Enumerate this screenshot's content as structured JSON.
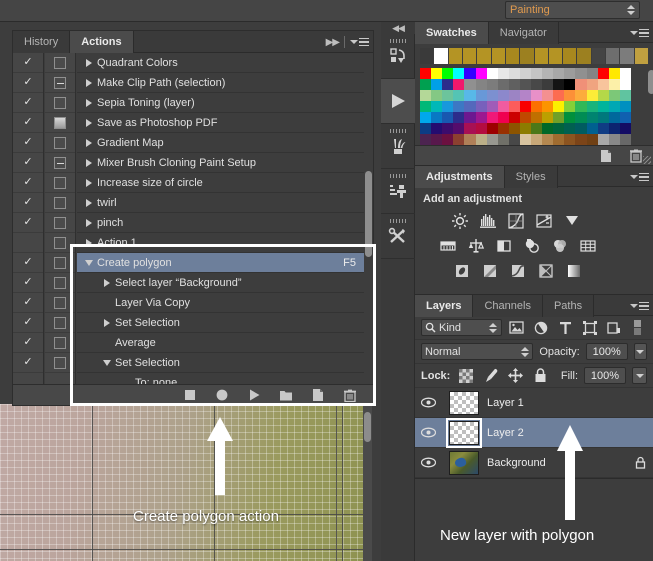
{
  "topbar": {
    "workspace": "Painting",
    "workspace_icon": "spinner-arrows-icon"
  },
  "actions_panel": {
    "tabs": [
      {
        "label": "History",
        "active": false
      },
      {
        "label": "Actions",
        "active": true
      }
    ],
    "header_icons": [
      "double-arrow-right-icon",
      "panel-menu-icon"
    ],
    "rows": [
      {
        "label": "Quadrant Colors",
        "indent": 0,
        "toggle": "right",
        "check": true,
        "dialog": "blank",
        "fkey": "",
        "selected": false
      },
      {
        "label": "Make Clip Path (selection)",
        "indent": 0,
        "toggle": "right",
        "check": true,
        "dialog": "dash",
        "fkey": "",
        "selected": false
      },
      {
        "label": "Sepia Toning (layer)",
        "indent": 0,
        "toggle": "right",
        "check": true,
        "dialog": "blank",
        "fkey": "",
        "selected": false
      },
      {
        "label": "Save as Photoshop PDF",
        "indent": 0,
        "toggle": "right",
        "check": true,
        "dialog": "filled",
        "fkey": "",
        "selected": false
      },
      {
        "label": "Gradient Map",
        "indent": 0,
        "toggle": "right",
        "check": true,
        "dialog": "blank",
        "fkey": "",
        "selected": false
      },
      {
        "label": "Mixer Brush Cloning Paint Setup",
        "indent": 0,
        "toggle": "right",
        "check": true,
        "dialog": "dash",
        "fkey": "",
        "selected": false
      },
      {
        "label": "Increase size of circle",
        "indent": 0,
        "toggle": "right",
        "check": true,
        "dialog": "blank",
        "fkey": "",
        "selected": false
      },
      {
        "label": "twirl",
        "indent": 0,
        "toggle": "right",
        "check": true,
        "dialog": "blank",
        "fkey": "",
        "selected": false
      },
      {
        "label": "pinch",
        "indent": 0,
        "toggle": "right",
        "check": true,
        "dialog": "blank",
        "fkey": "",
        "selected": false
      },
      {
        "label": "Action 1",
        "indent": 0,
        "toggle": "right",
        "check": false,
        "dialog": "blank",
        "fkey": "",
        "selected": false
      },
      {
        "label": "Create polygon",
        "indent": 0,
        "toggle": "down",
        "check": true,
        "dialog": "blank",
        "fkey": "F5",
        "selected": true
      },
      {
        "label": "Select layer “Background”",
        "indent": 1,
        "toggle": "right",
        "check": true,
        "dialog": "blank",
        "fkey": "",
        "selected": false
      },
      {
        "label": "Layer Via Copy",
        "indent": 1,
        "toggle": "none",
        "check": true,
        "dialog": "blank",
        "fkey": "",
        "selected": false
      },
      {
        "label": "Set Selection",
        "indent": 1,
        "toggle": "right",
        "check": true,
        "dialog": "blank",
        "fkey": "",
        "selected": false
      },
      {
        "label": "Average",
        "indent": 1,
        "toggle": "none",
        "check": true,
        "dialog": "blank",
        "fkey": "",
        "selected": false
      },
      {
        "label": "Set Selection",
        "indent": 1,
        "toggle": "down",
        "check": true,
        "dialog": "blank",
        "fkey": "",
        "selected": false
      },
      {
        "label": "To: none",
        "indent": 2,
        "toggle": "none",
        "check": false,
        "dialog": "none",
        "fkey": "",
        "selected": false
      }
    ],
    "footer_buttons": [
      {
        "name": "stop-recording-button",
        "icon": "square-icon"
      },
      {
        "name": "begin-recording-button",
        "icon": "circle-icon"
      },
      {
        "name": "play-selection-button",
        "icon": "play-triangle-icon"
      },
      {
        "name": "create-new-set-button",
        "icon": "folder-icon"
      },
      {
        "name": "create-new-action-button",
        "icon": "new-page-icon"
      },
      {
        "name": "delete-button",
        "icon": "trash-icon"
      }
    ]
  },
  "dock": {
    "items": [
      {
        "name": "mini-bridge-panel",
        "icon": "mini-bridge-icon",
        "active": false
      },
      {
        "name": "actions-play-panel",
        "icon": "play-triangle-icon",
        "active": true
      },
      {
        "name": "brush-presets-panel",
        "icon": "brushes-icon",
        "active": false
      },
      {
        "name": "clone-source-panel",
        "icon": "clone-stamp-icon",
        "active": false
      },
      {
        "name": "tool-presets-panel",
        "icon": "tools-cross-icon",
        "active": false
      }
    ]
  },
  "swatches_panel": {
    "tabs": [
      {
        "label": "Swatches",
        "active": true
      },
      {
        "label": "Navigator",
        "active": false
      }
    ],
    "recent": [
      "#3a3a3a",
      "#ffffff",
      "#b49424",
      "#b49424",
      "#b49424",
      "#b49424",
      "#a8881e",
      "#9c8020",
      "#b49424",
      "#b49424",
      "#a8881e",
      "#9c8020",
      "#444444",
      "#6e6e6e",
      "#7c7c7c",
      "#c0a040"
    ],
    "grid": [
      [
        "#ff0000",
        "#ffff00",
        "#00ff00",
        "#00ffff",
        "#3300ff",
        "#ff00ff",
        "#ffffff",
        "#e8e8e8",
        "#dcdcdc",
        "#d0d0d0",
        "#c4c4c4",
        "#b4b4b4",
        "#a8a8a8",
        "#9c9c9c",
        "#909090",
        "#848484",
        "#ff0000",
        "#ffe800",
        "#ffffff"
      ],
      [
        "#00a050",
        "#00a0e8",
        "#2c2c8c",
        "#f0186c",
        "#909090",
        "#848484",
        "#7c7c7c",
        "#6c6c6c",
        "#606060",
        "#545454",
        "#484848",
        "#3c3c3c",
        "#141414",
        "#000000",
        "#f09078",
        "#f0a480",
        "#f8c49c",
        "#fcf0a8",
        "#ffffff"
      ],
      [
        "#b4d898",
        "#84c884",
        "#6cc49c",
        "#54c4b4",
        "#58b8e8",
        "#6898d8",
        "#7c90d0",
        "#8c88cc",
        "#9c84c4",
        "#b484c8",
        "#e890c8",
        "#f49090",
        "#fc6c50",
        "#fc9038",
        "#fcac3c",
        "#fcec38",
        "#b4d848",
        "#7cc878",
        "#60c4a0"
      ],
      [
        "#00b878",
        "#00b8b8",
        "#1898dc",
        "#3c78c4",
        "#5468bc",
        "#7860bc",
        "#a05cb8",
        "#f05ca0",
        "#fc5c5c",
        "#f80000",
        "#fc7000",
        "#fc9400",
        "#fcf000",
        "#84d038",
        "#30b858",
        "#18b47c",
        "#00b49c",
        "#00a8b4",
        "#0090c0"
      ],
      [
        "#00a8ec",
        "#0878c4",
        "#1858b0",
        "#2c2c8c",
        "#6c1890",
        "#9c1890",
        "#f01878",
        "#f00050",
        "#cc0000",
        "#c04800",
        "#c07000",
        "#bca000",
        "#70a028",
        "#00903c",
        "#008c54",
        "#008470",
        "#00787c",
        "#00689c",
        "#1060b0"
      ],
      [
        "#0c3c84",
        "#240c70",
        "#3c0c6c",
        "#540c6c",
        "#a81054",
        "#b40c40",
        "#9c0000",
        "#983000",
        "#8c5400",
        "#8c7c00",
        "#4c7818",
        "#006828",
        "#00643c",
        "#006050",
        "#005c60",
        "#006090",
        "#103c84",
        "#0c2470",
        "#140c64"
      ],
      [
        "#4c2450",
        "#58184c",
        "#6c1040",
        "#8c4030",
        "#b08058",
        "#bcb088",
        "#989890",
        "#707068",
        "#484848",
        "#d8c4a0",
        "#c8a878",
        "#b48850",
        "#a06c30",
        "#8c5420",
        "#7c4418",
        "#704014",
        "#a8a8a8",
        "#888888",
        "#686868"
      ]
    ],
    "footer_buttons": [
      {
        "name": "new-swatch-button",
        "icon": "new-page-icon"
      },
      {
        "name": "delete-swatch-button",
        "icon": "trash-icon"
      }
    ]
  },
  "adjustments_panel": {
    "tabs": [
      {
        "label": "Adjustments",
        "active": true
      },
      {
        "label": "Styles",
        "active": false
      }
    ],
    "title": "Add an adjustment",
    "rows": [
      [
        {
          "name": "brightness-contrast-icon"
        },
        {
          "name": "levels-icon"
        },
        {
          "name": "curves-icon"
        },
        {
          "name": "exposure-icon"
        },
        {
          "name": "vibrance-icon"
        }
      ],
      [
        {
          "name": "hue-saturation-icon"
        },
        {
          "name": "color-balance-icon"
        },
        {
          "name": "black-white-icon"
        },
        {
          "name": "photo-filter-icon"
        },
        {
          "name": "channel-mixer-icon"
        },
        {
          "name": "color-lookup-icon"
        }
      ],
      [
        {
          "name": "invert-icon"
        },
        {
          "name": "posterize-icon"
        },
        {
          "name": "threshold-icon"
        },
        {
          "name": "selective-color-icon"
        },
        {
          "name": "gradient-map-icon"
        }
      ]
    ]
  },
  "layers_panel": {
    "tabs": [
      {
        "label": "Layers",
        "active": true
      },
      {
        "label": "Channels",
        "active": false
      },
      {
        "label": "Paths",
        "active": false
      }
    ],
    "filter": {
      "label": "Kind",
      "icon": "search-icon"
    },
    "filter_icons": [
      "pixel-layer-filter-icon",
      "adjustment-layer-filter-icon",
      "type-layer-filter-icon",
      "shape-layer-filter-icon",
      "smart-object-filter-icon",
      "filter-toggle-icon"
    ],
    "blend_mode": "Normal",
    "opacity_label": "Opacity:",
    "opacity_value": "100%",
    "lock_label": "Lock:",
    "lock_icons": [
      "lock-transparency-icon",
      "lock-image-icon",
      "lock-position-icon",
      "lock-all-icon"
    ],
    "fill_label": "Fill:",
    "fill_value": "100%",
    "layers": [
      {
        "name": "Layer 1",
        "thumb": "checker",
        "visible": true,
        "selected": false,
        "locked": false
      },
      {
        "name": "Layer 2",
        "thumb": "checker",
        "visible": true,
        "selected": true,
        "locked": false
      },
      {
        "name": "Background",
        "thumb": "photo",
        "visible": true,
        "selected": false,
        "locked": true
      }
    ]
  },
  "annotations": {
    "left_label": "Create polygon action",
    "right_label": "New layer with polygon",
    "arrow_icon": "up-arrow-icon",
    "highlight_color": "#ffffff"
  }
}
